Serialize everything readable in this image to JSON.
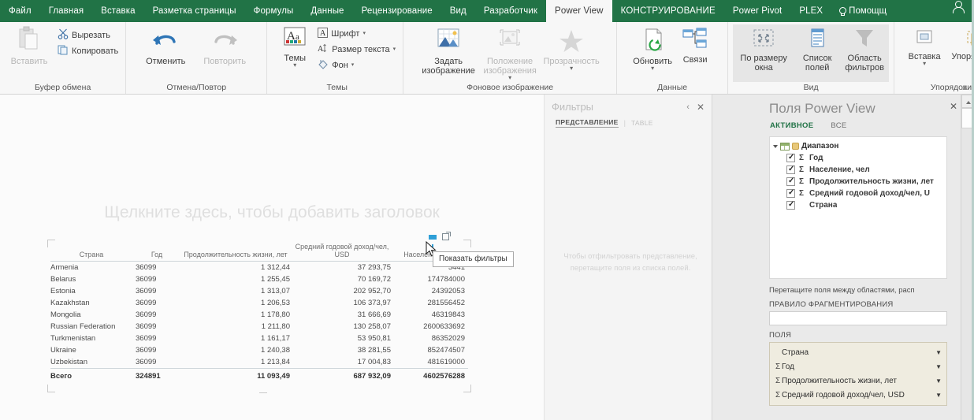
{
  "ribbon_tabs": [
    {
      "label": "Файл",
      "active": false
    },
    {
      "label": "Главная",
      "active": false
    },
    {
      "label": "Вставка",
      "active": false
    },
    {
      "label": "Разметка страницы",
      "active": false
    },
    {
      "label": "Формулы",
      "active": false
    },
    {
      "label": "Данные",
      "active": false
    },
    {
      "label": "Рецензирование",
      "active": false
    },
    {
      "label": "Вид",
      "active": false
    },
    {
      "label": "Разработчик",
      "active": false
    },
    {
      "label": "Power View",
      "active": true
    },
    {
      "label": "КОНСТРУИРОВАНИЕ",
      "active": false
    },
    {
      "label": "Power Pivot",
      "active": false
    },
    {
      "label": "PLEX",
      "active": false
    }
  ],
  "help": {
    "label": "Помощщ"
  },
  "ribbon": {
    "clipboard": {
      "title": "Буфер обмена",
      "paste": "Вставить",
      "cut": "Вырезать",
      "copy": "Копировать"
    },
    "undo": {
      "title": "Отмена/Повтор",
      "undo": "Отменить",
      "redo": "Повторить"
    },
    "themes": {
      "title": "Темы",
      "themes": "Темы",
      "font": "Шрифт",
      "text_size": "Размер текста",
      "background": "Фон"
    },
    "background_image": {
      "title": "Фоновое изображение",
      "set_image_line1": "Задать",
      "set_image_line2": "изображение",
      "position_line1": "Положение",
      "position_line2": "изображения",
      "transparency": "Прозрачность"
    },
    "data": {
      "title": "Данные",
      "refresh": "Обновить",
      "relationships": "Связи"
    },
    "view": {
      "title": "Вид",
      "fit_line1": "По размеру",
      "fit_line2": "окна",
      "fields_line1": "Список",
      "fields_line2": "полей",
      "filters_line1": "Область",
      "filters_line2": "фильтров"
    },
    "insert": {
      "title": "Упорядочить",
      "insert": "Вставка",
      "arrange": "Упорядочить"
    }
  },
  "report": {
    "title_placeholder": "Щелкните здесь, чтобы добавить заголовок",
    "tooltip": "Показать фильтры"
  },
  "table": {
    "headers": [
      "Страна",
      "Год",
      "Продолжительность жизни, лет",
      "Средний годовой доход/чел, USD",
      "Население, чел"
    ],
    "rows": [
      {
        "country": "Armenia",
        "year": "36099",
        "life": "1 312,44",
        "income": "37 293,75",
        "population": "5441"
      },
      {
        "country": "Belarus",
        "year": "36099",
        "life": "1 255,45",
        "income": "70 169,72",
        "population": "174784000"
      },
      {
        "country": "Estonia",
        "year": "36099",
        "life": "1 313,07",
        "income": "202 952,70",
        "population": "24392053"
      },
      {
        "country": "Kazakhstan",
        "year": "36099",
        "life": "1 206,53",
        "income": "106 373,97",
        "population": "281556452"
      },
      {
        "country": "Mongolia",
        "year": "36099",
        "life": "1 178,80",
        "income": "31 666,69",
        "population": "46319843"
      },
      {
        "country": "Russian Federation",
        "year": "36099",
        "life": "1 211,80",
        "income": "130 258,07",
        "population": "2600633692"
      },
      {
        "country": "Turkmenistan",
        "year": "36099",
        "life": "1 161,17",
        "income": "53 950,81",
        "population": "86352029"
      },
      {
        "country": "Ukraine",
        "year": "36099",
        "life": "1 240,38",
        "income": "38 281,55",
        "population": "852474507"
      },
      {
        "country": "Uzbekistan",
        "year": "36099",
        "life": "1 213,84",
        "income": "17 004,83",
        "population": "481619000"
      }
    ],
    "total": {
      "label": "Всего",
      "year": "324891",
      "life": "11 093,49",
      "income": "687 932,09",
      "population": "4602576288"
    }
  },
  "filters_pane": {
    "title": "Фильтры",
    "tab_view": "ПРЕДСТАВЛЕНИЕ",
    "tab_table": "TABLE",
    "hint_line1": "Чтобы отфильтровать представление,",
    "hint_line2": "перетащите поля из списка полей."
  },
  "fields_pane": {
    "title": "Поля Power View",
    "tab_active": "АКТИВНОЕ",
    "tab_all": "ВСЕ",
    "tree_root": "Диапазон",
    "tree_fields": [
      {
        "label": "Год",
        "sigma": true,
        "checked": true
      },
      {
        "label": "Население, чел",
        "sigma": true,
        "checked": true
      },
      {
        "label": "Продолжительность жизни, лет",
        "sigma": true,
        "checked": true
      },
      {
        "label": "Средний годовой доход/чел, U",
        "sigma": true,
        "checked": true
      },
      {
        "label": "Страна",
        "sigma": false,
        "checked": true
      }
    ],
    "drag_hint": "Перетащите поля между областями, расп",
    "slicer_label": "ПРАВИЛО ФРАГМЕНТИРОВАНИЯ",
    "fields_label": "ПОЛЯ",
    "field_rows": [
      {
        "label": "Страна",
        "sigma": false
      },
      {
        "label": "Год",
        "sigma": true
      },
      {
        "label": "Продолжительность жизни, лет",
        "sigma": true
      },
      {
        "label": "Средний годовой доход/чел, USD",
        "sigma": true
      }
    ]
  },
  "colors": {
    "ribbon_green": "#217346",
    "accent_blue": "#2e9fd7"
  }
}
